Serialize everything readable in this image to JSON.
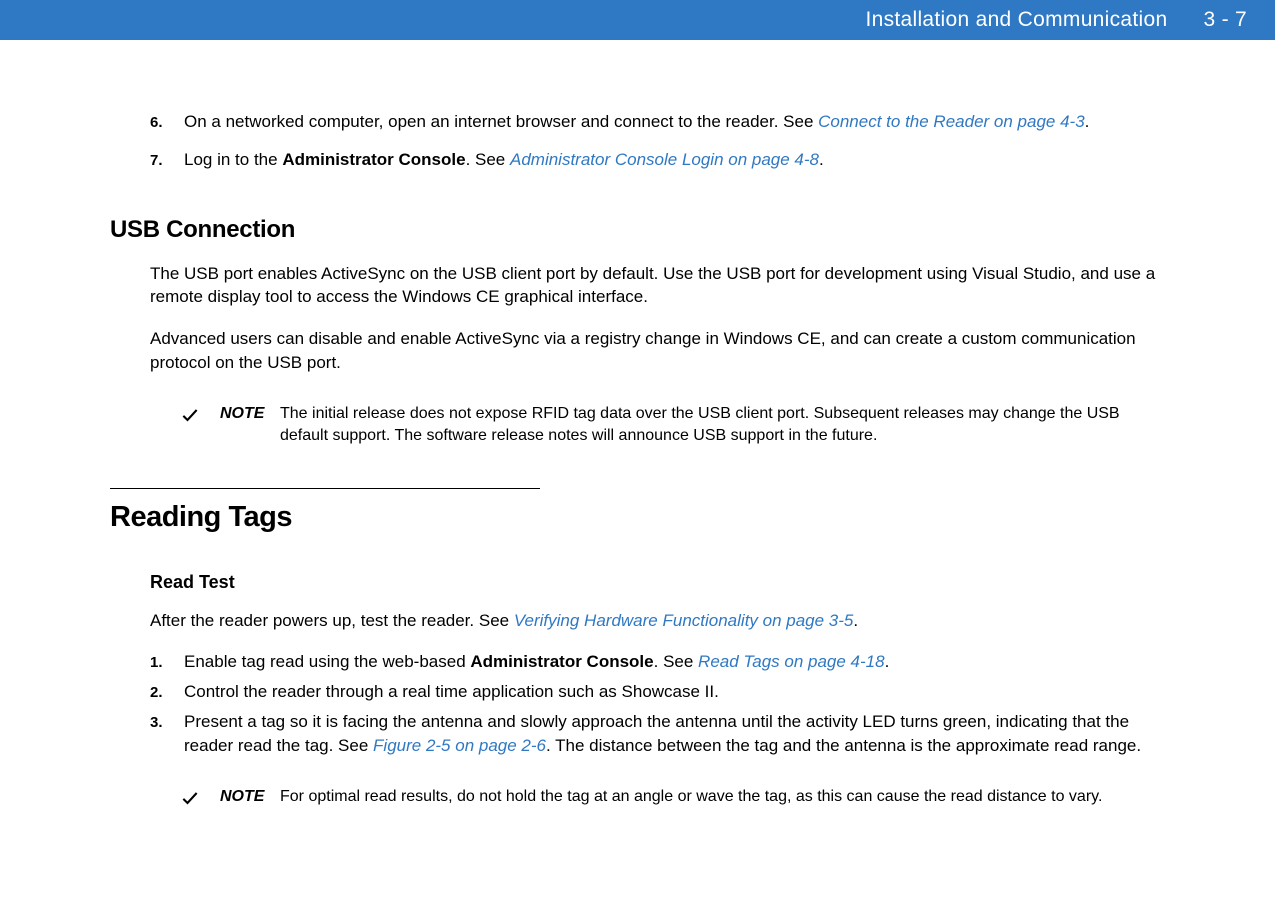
{
  "header": {
    "chapter_title": "Installation and Communication",
    "page_num": "3 - 7"
  },
  "step6": {
    "num": "6.",
    "text_a": "On a networked computer, open an internet browser and connect to the reader. See ",
    "link": "Connect to the Reader on page 4-3",
    "text_b": "."
  },
  "step7": {
    "num": "7.",
    "text_a": "Log in to the ",
    "bold": "Administrator Console",
    "text_b": ". See ",
    "link": "Administrator Console Login on page 4-8",
    "text_c": "."
  },
  "usb_heading": "USB Connection",
  "usb_p1": "The USB port enables ActiveSync on the USB client port by default. Use the USB port for development using Visual Studio, and use a remote display tool to access the Windows CE graphical interface.",
  "usb_p2": "Advanced users can disable and enable ActiveSync via a registry change in Windows CE, and can create a custom communication protocol on the USB port.",
  "note1": {
    "label": "NOTE",
    "text": "The initial release does not expose RFID tag data over the USB client port. Subsequent releases may change the USB default support. The software release notes will announce USB support in the future."
  },
  "reading_tags_heading": "Reading Tags",
  "read_test_heading": "Read Test",
  "read_test_intro": {
    "text_a": "After the reader powers up, test the reader. See ",
    "link": "Verifying Hardware Functionality on page 3-5",
    "text_b": "."
  },
  "rt_step1": {
    "num": "1.",
    "text_a": "Enable tag read using the web-based ",
    "bold": "Administrator Console",
    "text_b": ". See ",
    "link": "Read Tags on page 4-18",
    "text_c": "."
  },
  "rt_step2": {
    "num": "2.",
    "text": "Control the reader through a real time application such as Showcase II."
  },
  "rt_step3": {
    "num": "3.",
    "text_a": "Present a tag so it is facing the antenna and slowly approach the antenna until the activity LED turns green, indicating that the reader read the tag. See ",
    "link": "Figure 2-5 on page 2-6",
    "text_b": ". The distance between the tag and the antenna is the approximate read range."
  },
  "note2": {
    "label": "NOTE",
    "text": "For optimal read results, do not hold the tag at an angle or wave the tag, as this can cause the read distance to vary."
  }
}
